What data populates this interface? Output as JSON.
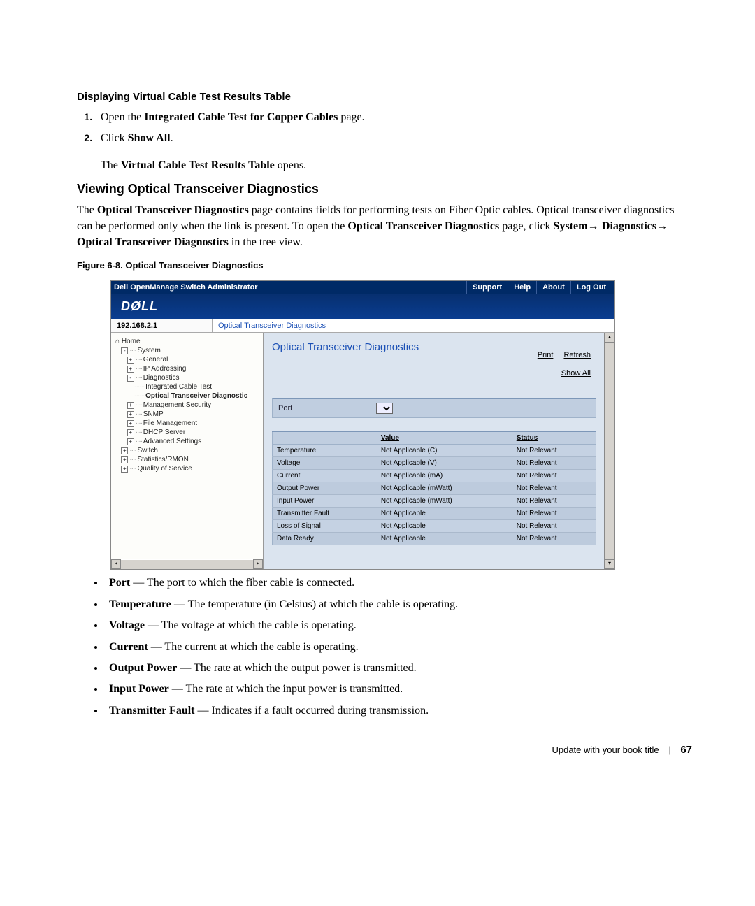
{
  "headings": {
    "sub1": "Displaying Virtual Cable Test Results Table",
    "h2": "Viewing Optical Transceiver Diagnostics",
    "figcap": "Figure 6-8.   Optical Transceiver Diagnostics"
  },
  "steps": {
    "s1_pre": "Open the ",
    "s1_bold": "Integrated Cable Test for Copper Cables",
    "s1_post": " page.",
    "s2_pre": "Click ",
    "s2_bold": "Show All",
    "s2_post": ".",
    "res_pre": "The ",
    "res_bold": "Virtual Cable Test Results Table",
    "res_post": " opens."
  },
  "para": {
    "p1a": "The ",
    "p1b": "Optical Transceiver Diagnostics",
    "p1c": " page contains fields for performing tests on Fiber Optic cables. Optical transceiver diagnostics can be performed only when the link is present. To open the ",
    "p1d": "Optical Transceiver Diagnostics",
    "p1e": " page, click ",
    "p1f": "System",
    "p1g": "→ ",
    "p1h": "Diagnostics",
    "p1i": "→ ",
    "p1j": "Optical Transceiver Diagnostics",
    "p1k": " in the tree view."
  },
  "screenshot": {
    "titlebar": {
      "title": "Dell OpenManage Switch Administrator",
      "links": [
        "Support",
        "Help",
        "About",
        "Log Out"
      ]
    },
    "logo": "DØLL",
    "ip": "192.168.2.1",
    "crumb": "Optical Transceiver Diagnostics",
    "tree": [
      {
        "d": 0,
        "b": "",
        "t": "Home",
        "icon": "⌂"
      },
      {
        "d": 1,
        "b": "-",
        "t": "System"
      },
      {
        "d": 2,
        "b": "+",
        "t": "General"
      },
      {
        "d": 2,
        "b": "+",
        "t": "IP Addressing"
      },
      {
        "d": 2,
        "b": "-",
        "t": "Diagnostics"
      },
      {
        "d": 3,
        "b": "",
        "t": "Integrated Cable Test"
      },
      {
        "d": 3,
        "b": "",
        "t": "Optical Transceiver Diagnostic",
        "hl": true
      },
      {
        "d": 2,
        "b": "+",
        "t": "Management Security"
      },
      {
        "d": 2,
        "b": "+",
        "t": "SNMP"
      },
      {
        "d": 2,
        "b": "+",
        "t": "File Management"
      },
      {
        "d": 2,
        "b": "+",
        "t": "DHCP Server"
      },
      {
        "d": 2,
        "b": "+",
        "t": "Advanced Settings"
      },
      {
        "d": 1,
        "b": "+",
        "t": "Switch"
      },
      {
        "d": 1,
        "b": "+",
        "t": "Statistics/RMON"
      },
      {
        "d": 1,
        "b": "+",
        "t": "Quality of Service"
      }
    ],
    "main": {
      "title": "Optical Transceiver Diagnostics",
      "links": {
        "print": "Print",
        "refresh": "Refresh",
        "showall": "Show All"
      },
      "port_label": "Port",
      "table": {
        "headers": [
          "",
          "Value",
          "Status"
        ],
        "rows": [
          [
            "Temperature",
            "Not Applicable (C)",
            "Not Relevant"
          ],
          [
            "Voltage",
            "Not Applicable (V)",
            "Not Relevant"
          ],
          [
            "Current",
            "Not Applicable (mA)",
            "Not Relevant"
          ],
          [
            "Output Power",
            "Not Applicable (mWatt)",
            "Not Relevant"
          ],
          [
            "Input Power",
            "Not Applicable (mWatt)",
            "Not Relevant"
          ],
          [
            "Transmitter Fault",
            "Not Applicable",
            "Not Relevant"
          ],
          [
            "Loss of Signal",
            "Not Applicable",
            "Not Relevant"
          ],
          [
            "Data Ready",
            "Not Applicable",
            "Not Relevant"
          ]
        ]
      }
    }
  },
  "fields": [
    {
      "b": "Port",
      "t": " — The port to which the fiber cable is connected."
    },
    {
      "b": "Temperature",
      "t": " — The temperature (in Celsius) at which the cable is operating."
    },
    {
      "b": "Voltage",
      "t": " — The voltage at which the cable is operating."
    },
    {
      "b": "Current",
      "t": " — The current at which the cable is operating."
    },
    {
      "b": "Output Power",
      "t": " — The rate at which the output power is transmitted."
    },
    {
      "b": "Input Power",
      "t": " — The rate at which the input power is transmitted."
    },
    {
      "b": "Transmitter Fault",
      "t": " — Indicates if a fault occurred during transmission."
    }
  ],
  "footer": {
    "title": "Update with your book title",
    "page": "67"
  }
}
